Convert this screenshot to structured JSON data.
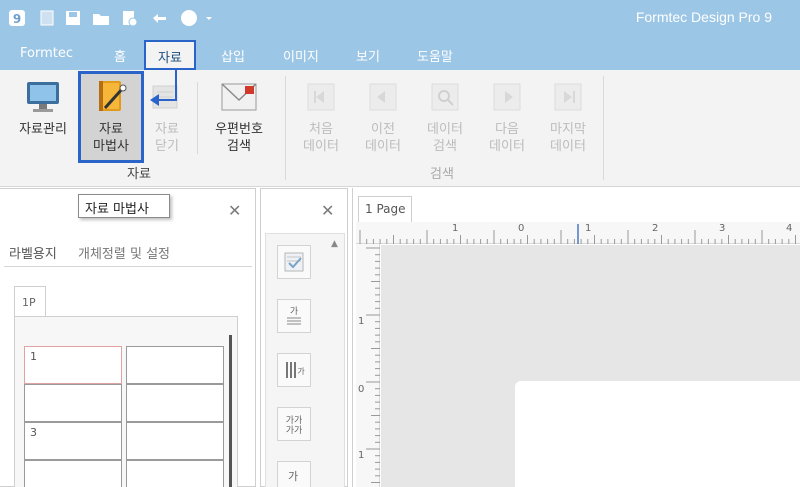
{
  "app": {
    "title": "Formtec Design Pro 9"
  },
  "menu": {
    "tabs": [
      {
        "label": "Formtec"
      },
      {
        "label": "홈"
      },
      {
        "label": "자료"
      },
      {
        "label": "삽입"
      },
      {
        "label": "이미지"
      },
      {
        "label": "보기"
      },
      {
        "label": "도움말"
      }
    ]
  },
  "ribbon": {
    "data_group": {
      "label": "자료",
      "buttons": [
        {
          "label": "자료관리"
        },
        {
          "label": "자료\n마법사"
        },
        {
          "label": "자료\n닫기"
        },
        {
          "label": "우편번호\n검색"
        }
      ]
    },
    "search_group": {
      "label": "검색",
      "buttons": [
        {
          "label": "처음\n데이터"
        },
        {
          "label": "이전\n데이터"
        },
        {
          "label": "데이터\n검색"
        },
        {
          "label": "다음\n데이터"
        },
        {
          "label": "마지막\n데이터"
        }
      ]
    }
  },
  "tooltip": {
    "text": "자료 마법사"
  },
  "left_panel": {
    "subtabs": [
      {
        "label": "라벨용지"
      },
      {
        "label": "개체정렬 및 설정"
      }
    ],
    "page_tab": "1P",
    "cells": [
      {
        "num": "1"
      },
      {
        "num": ""
      },
      {
        "num": ""
      },
      {
        "num": ""
      },
      {
        "num": "3"
      },
      {
        "num": ""
      },
      {
        "num": ""
      },
      {
        "num": ""
      }
    ]
  },
  "canvas": {
    "page_tab": "1 Page",
    "ruler_h_labels": [
      "1",
      "0",
      "1",
      "2",
      "3",
      "4"
    ],
    "ruler_v_labels": [
      "1",
      "0",
      "1"
    ]
  },
  "colors": {
    "titlebar": "#9cc6e6",
    "highlight": "#2a64c8",
    "ribbon_bg": "#f3f3f3"
  }
}
